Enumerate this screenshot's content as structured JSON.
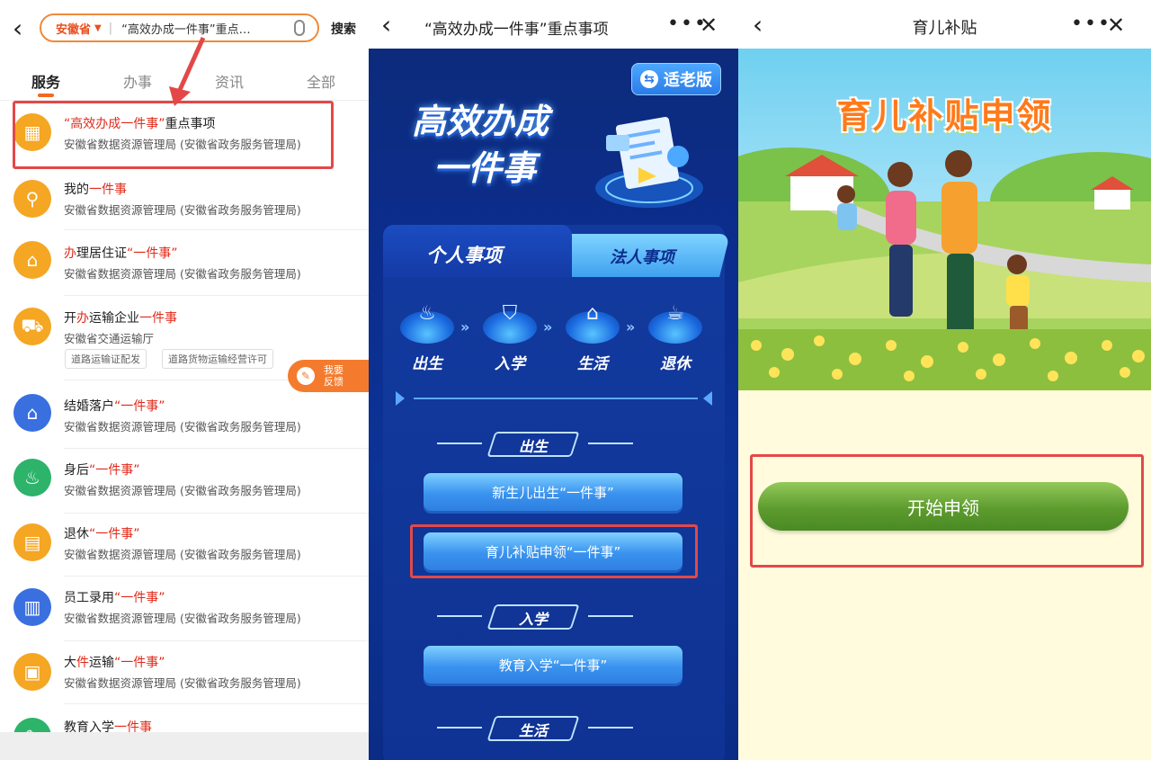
{
  "panel1": {
    "back_icon": "chevron-left-icon",
    "search": {
      "province": "安徽省",
      "query": "“高效办成一件事”重点…",
      "button": "搜索"
    },
    "tabs": [
      "服务",
      "办事",
      "资讯",
      "全部"
    ],
    "items": [
      {
        "title_pre": "“高效办成一件事”",
        "title_hl": "",
        "title_post": "重点事项",
        "hl_quote": true,
        "sub": "安徽省数据资源管理局 (安徽省政务服务管理局)",
        "icon": "calendar-icon",
        "color": "#f5a623"
      },
      {
        "title_pre": "我的",
        "title_hl": "一件事",
        "title_post": "",
        "sub": "安徽省数据资源管理局 (安徽省政务服务管理局)",
        "icon": "search-hand-icon",
        "color": "#f5a623"
      },
      {
        "title_pre": "",
        "title_hl": "办",
        "title_post": "理居住证",
        "title_hl2": "“一件事”",
        "sub": "安徽省数据资源管理局 (安徽省政务服务管理局)",
        "icon": "house-icon",
        "color": "#f5a623"
      },
      {
        "title_pre": "开",
        "title_hl": "办",
        "title_post": "运输企业",
        "title_hl2": "一件事",
        "sub": "安徽省交通运输厅",
        "icon": "truck-icon",
        "color": "#f5a623",
        "tags": [
          "道路运输证配发",
          "道路货物运输经营许可"
        ]
      },
      {
        "title_pre": "结婚落户",
        "title_hl": "“一件事”",
        "title_post": "",
        "sub": "安徽省数据资源管理局 (安徽省政务服务管理局)",
        "icon": "home-family-icon",
        "color": "#3a6fe0"
      },
      {
        "title_pre": "身后",
        "title_hl": "“一件事”",
        "title_post": "",
        "sub": "安徽省数据资源管理局 (安徽省政务服务管理局)",
        "icon": "memorial-icon",
        "color": "#2db36a"
      },
      {
        "title_pre": "退休",
        "title_hl": "“一件事”",
        "title_post": "",
        "sub": "安徽省数据资源管理局 (安徽省政务服务管理局)",
        "icon": "retire-doc-icon",
        "color": "#f5a623"
      },
      {
        "title_pre": "员工录用",
        "title_hl": "“一件事”",
        "title_post": "",
        "sub": "安徽省数据资源管理局 (安徽省政务服务管理局)",
        "icon": "form-icon",
        "color": "#3a6fe0"
      },
      {
        "title_pre": "大",
        "title_hl": "件",
        "title_post": "运输",
        "title_hl2": "“一件事”",
        "sub": "安徽省数据资源管理局 (安徽省政务服务管理局)",
        "icon": "cargo-icon",
        "color": "#f5a623"
      },
      {
        "title_pre": "教育入学",
        "title_hl": "一件事",
        "title_post": "",
        "sub": "",
        "icon": "school-icon",
        "color": "#2db36a"
      }
    ],
    "feedback": "我要\n反馈"
  },
  "panel2": {
    "title": "“高效办成一件事”重点事项",
    "elder_mode": "适老版",
    "hero_line1": "高效办成",
    "hero_line2": "一件事",
    "tab_personal": "个人事项",
    "tab_legal": "法人事项",
    "stages": [
      "出生",
      "入学",
      "生活",
      "退休"
    ],
    "section_birth": "出生",
    "btn_newborn": "新生儿出生“一件事”",
    "btn_subsidy": "育儿补贴申领“一件事”",
    "section_school": "入学",
    "btn_school": "教育入学“一件事”",
    "section_life": "生活"
  },
  "panel3": {
    "title": "育儿补贴",
    "banner": "育儿补贴申领",
    "start_button": "开始申领"
  },
  "colors": {
    "highlight_red": "#e02a1a",
    "annotation_red": "#e34848",
    "orange_accent": "#f06a1f",
    "blue_bg": "#0c3396",
    "green_button": "#5d9b2e"
  }
}
